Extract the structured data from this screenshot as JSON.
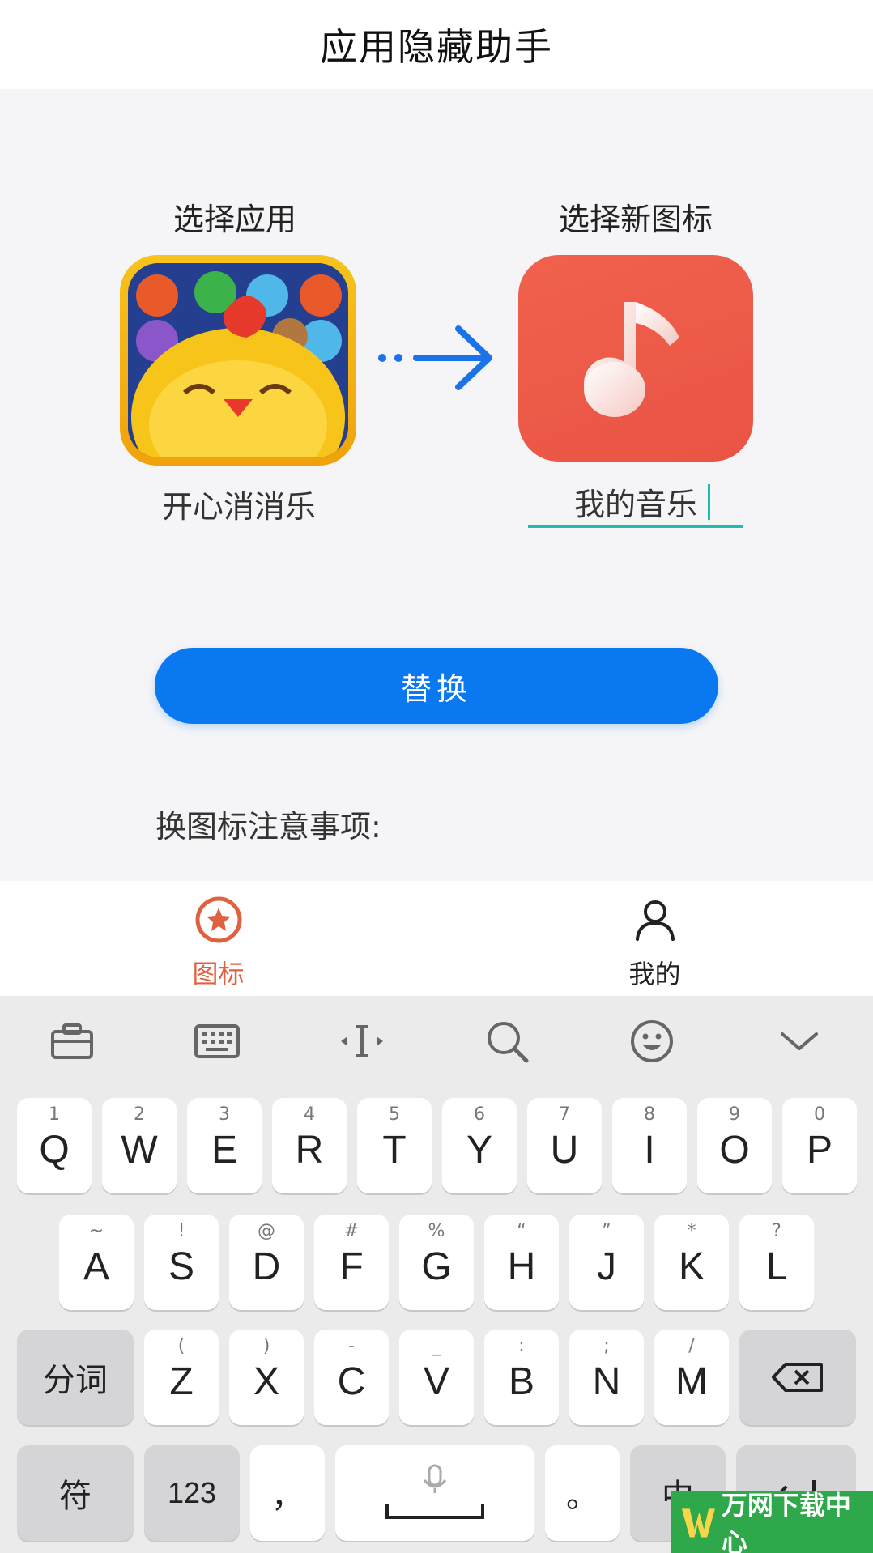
{
  "header": {
    "title": "应用隐藏助手"
  },
  "picker": {
    "select_app_label": "选择应用",
    "select_icon_label": "选择新图标",
    "app_name": "开心消消乐",
    "new_name": "我的音乐"
  },
  "actions": {
    "replace_label": "替换"
  },
  "notes": {
    "title": "换图标注意事项:"
  },
  "tabbar": {
    "tabs": [
      {
        "label": "图标",
        "icon": "star-circle-icon",
        "active": true
      },
      {
        "label": "我的",
        "icon": "person-icon",
        "active": false
      }
    ]
  },
  "keyboard": {
    "toolbar": [
      "briefcase-icon",
      "keyboard-icon",
      "cursor-icon",
      "search-icon",
      "emoji-icon",
      "chevron-down-icon"
    ],
    "row1": [
      {
        "k": "Q",
        "s": "1"
      },
      {
        "k": "W",
        "s": "2"
      },
      {
        "k": "E",
        "s": "3"
      },
      {
        "k": "R",
        "s": "4"
      },
      {
        "k": "T",
        "s": "5"
      },
      {
        "k": "Y",
        "s": "6"
      },
      {
        "k": "U",
        "s": "7"
      },
      {
        "k": "I",
        "s": "8"
      },
      {
        "k": "O",
        "s": "9"
      },
      {
        "k": "P",
        "s": "0"
      }
    ],
    "row2": [
      {
        "k": "A",
        "s": "~"
      },
      {
        "k": "S",
        "s": "!"
      },
      {
        "k": "D",
        "s": "@"
      },
      {
        "k": "F",
        "s": "#"
      },
      {
        "k": "G",
        "s": "%"
      },
      {
        "k": "H",
        "s": "“"
      },
      {
        "k": "J",
        "s": "”"
      },
      {
        "k": "K",
        "s": "*"
      },
      {
        "k": "L",
        "s": "?"
      }
    ],
    "row3": [
      {
        "k": "Z",
        "s": "("
      },
      {
        "k": "X",
        "s": ")"
      },
      {
        "k": "C",
        "s": "-"
      },
      {
        "k": "V",
        "s": "_"
      },
      {
        "k": "B",
        "s": ":"
      },
      {
        "k": "N",
        "s": ";"
      },
      {
        "k": "M",
        "s": "/"
      }
    ],
    "segment_label": "分词",
    "symbols_label": "符",
    "numbers_label": "123",
    "comma_label": "，",
    "period_label": "。",
    "lang_label": "中"
  },
  "watermark": {
    "text": "万网下载中心"
  },
  "colors": {
    "accent": "#0a78f0",
    "tab_active": "#e0613f",
    "input_underline": "#1fbcb0",
    "music_icon": "#ea5445"
  }
}
